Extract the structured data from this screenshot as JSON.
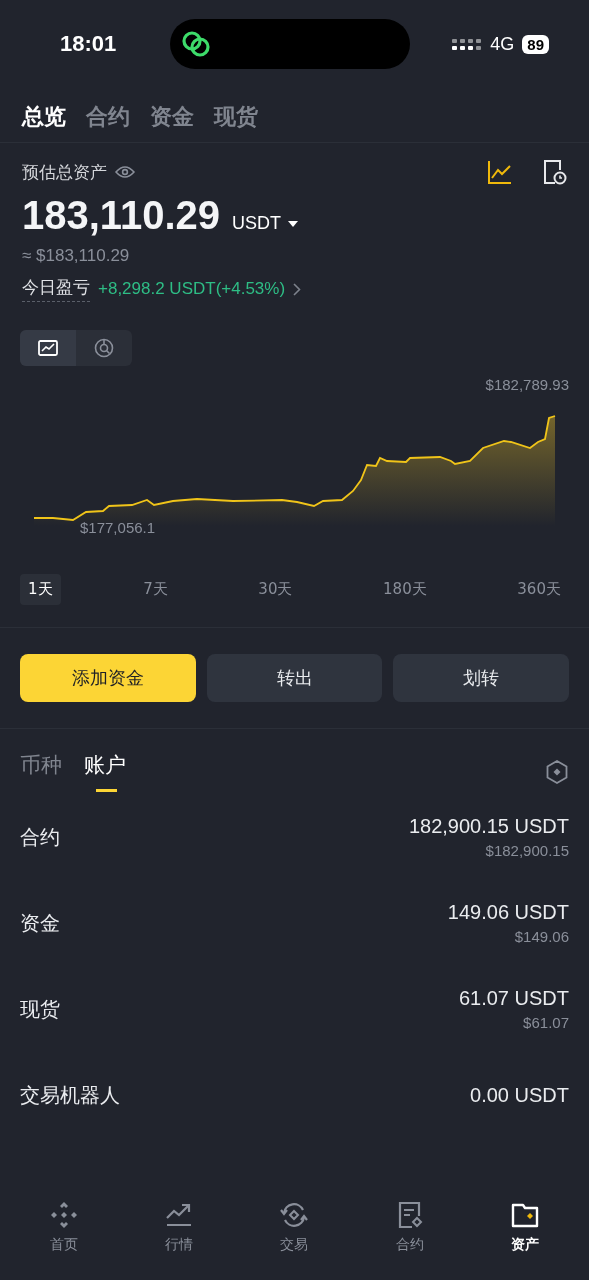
{
  "status_bar": {
    "time": "18:01",
    "network": "4G",
    "battery": "89"
  },
  "tabs": [
    {
      "label": "总览",
      "selected": true
    },
    {
      "label": "合约",
      "selected": false
    },
    {
      "label": "资金",
      "selected": false
    },
    {
      "label": "现货",
      "selected": false
    }
  ],
  "summary": {
    "label": "预估总资产",
    "amount": "183,110.29",
    "currency": "USDT",
    "approx": "≈ $183,110.29",
    "pnl_label": "今日盈亏",
    "pnl_value": "+8,298.2 USDT(+4.53%)"
  },
  "chart_toggle": [
    {
      "kind": "line",
      "selected": true
    },
    {
      "kind": "pie",
      "selected": false
    }
  ],
  "chart": {
    "high_label": "$182,789.93",
    "low_label": "$177,056.1"
  },
  "ranges": [
    {
      "label": "1天",
      "selected": true
    },
    {
      "label": "7天",
      "selected": false
    },
    {
      "label": "30天",
      "selected": false
    },
    {
      "label": "180天",
      "selected": false
    },
    {
      "label": "360天",
      "selected": false
    }
  ],
  "actions": [
    {
      "label": "添加资金",
      "primary": true
    },
    {
      "label": "转出",
      "primary": false
    },
    {
      "label": "划转",
      "primary": false
    }
  ],
  "account_tabs": [
    {
      "label": "币种",
      "selected": false
    },
    {
      "label": "账户",
      "selected": true
    }
  ],
  "accounts": [
    {
      "name": "合约",
      "amount": "182,900.15 USDT",
      "usd": "$182,900.15"
    },
    {
      "name": "资金",
      "amount": "149.06 USDT",
      "usd": "$149.06"
    },
    {
      "name": "现货",
      "amount": "61.07 USDT",
      "usd": "$61.07"
    },
    {
      "name": "交易机器人",
      "amount": "0.00 USDT"
    }
  ],
  "nav": [
    {
      "kind": "home",
      "label": "首页",
      "selected": false
    },
    {
      "kind": "markets",
      "label": "行情",
      "selected": false
    },
    {
      "kind": "trade",
      "label": "交易",
      "selected": false
    },
    {
      "kind": "futures",
      "label": "合约",
      "selected": false
    },
    {
      "kind": "assets",
      "label": "资产",
      "selected": true
    }
  ]
}
